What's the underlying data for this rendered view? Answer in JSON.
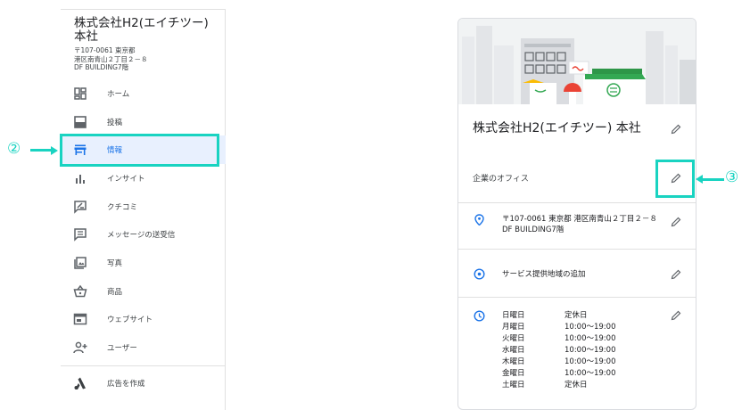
{
  "sidebar": {
    "business_name": "株式会社H2(エイチツー) 本社",
    "address_lines": [
      "〒107-0061 東京都",
      "港区南青山２丁目２－８",
      "DF BUILDING7階"
    ],
    "items": [
      {
        "label": "ホーム",
        "icon": "home-grid-icon"
      },
      {
        "label": "投稿",
        "icon": "post-icon"
      },
      {
        "label": "情報",
        "icon": "storefront-icon",
        "active": true
      },
      {
        "label": "インサイト",
        "icon": "bar-chart-icon"
      },
      {
        "label": "クチコミ",
        "icon": "review-icon"
      },
      {
        "label": "メッセージの送受信",
        "icon": "message-icon"
      },
      {
        "label": "写真",
        "icon": "photo-icon"
      },
      {
        "label": "商品",
        "icon": "basket-icon"
      },
      {
        "label": "ウェブサイト",
        "icon": "website-icon"
      },
      {
        "label": "ユーザー",
        "icon": "add-user-icon"
      }
    ],
    "footer_item": {
      "label": "広告を作成",
      "icon": "google-ads-icon"
    }
  },
  "annotations": {
    "marker_2": "②",
    "marker_3": "③",
    "color": "#19d3c1"
  },
  "card": {
    "title": "株式会社H2(エイチツー) 本社",
    "category": "企業のオフィス",
    "address": "〒107-0061 東京都 港区南青山２丁目２－８ DF BUILDING7階",
    "service_area": "サービス提供地域の追加",
    "hours": [
      {
        "day": "日曜日",
        "time": "定休日"
      },
      {
        "day": "月曜日",
        "time": "10:00～19:00"
      },
      {
        "day": "火曜日",
        "time": "10:00～19:00"
      },
      {
        "day": "水曜日",
        "time": "10:00～19:00"
      },
      {
        "day": "木曜日",
        "time": "10:00～19:00"
      },
      {
        "day": "金曜日",
        "time": "10:00～19:00"
      },
      {
        "day": "土曜日",
        "time": "定休日"
      }
    ]
  },
  "colors": {
    "accent_blue": "#1a73e8",
    "active_bg": "#e8f0fe",
    "icon_gray": "#5f6368"
  }
}
